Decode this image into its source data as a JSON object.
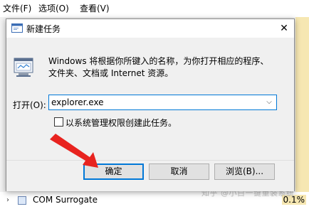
{
  "background_window": {
    "menu": [
      "文件(F)",
      "选项(O)",
      "查看(V)"
    ],
    "process_row": {
      "expander": "›",
      "name": "COM Surrogate",
      "cpu": "0.1%"
    },
    "watermark": "知乎 @小白一键重装系统"
  },
  "dialog": {
    "title": "新建任务",
    "close_glyph": "✕",
    "description_line1": "Windows 将根据你所键入的名称，为你打开相应的程序、",
    "description_line2": "文件夹、文档或 Internet 资源。",
    "open_label": "打开(O):",
    "open_value": "explorer.exe",
    "dropdown_glyph": "⌵",
    "admin_checkbox_label": "以系统管理权限创建此任务。",
    "admin_checked": false,
    "buttons": {
      "ok": "确定",
      "cancel": "取消",
      "browse": "浏览(B)..."
    }
  },
  "colors": {
    "accent": "#0078d7",
    "annotation": "#e8231f",
    "highlight": "#f6e7b2"
  }
}
